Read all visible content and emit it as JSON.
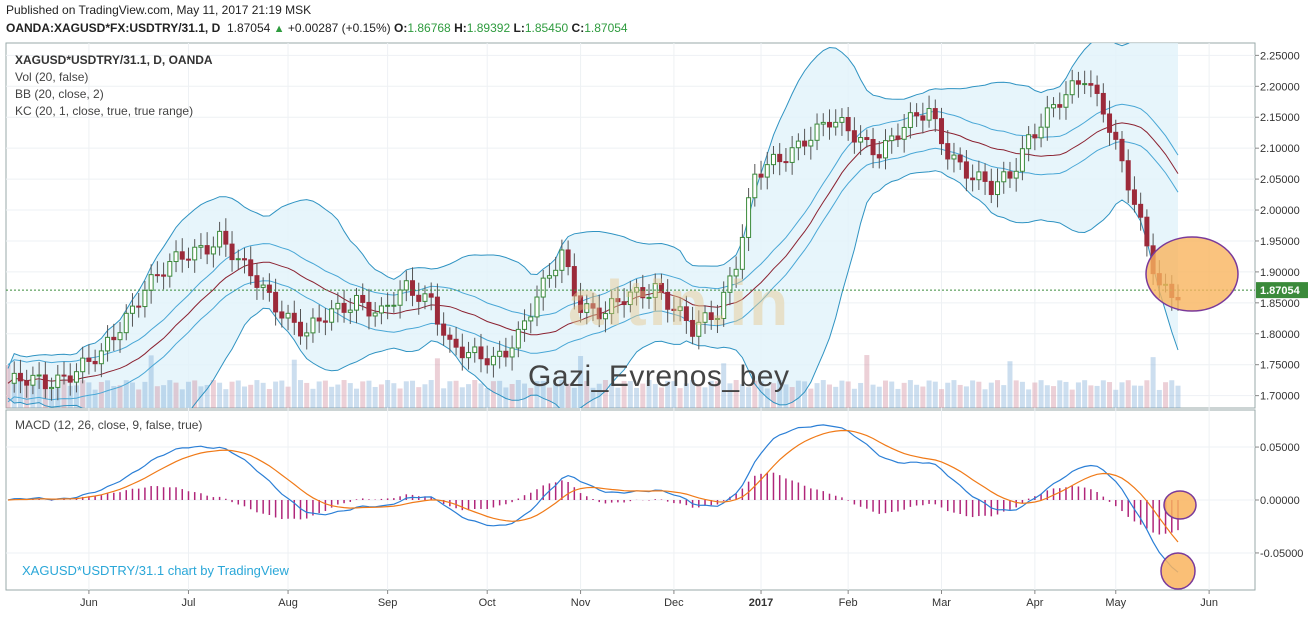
{
  "header": {
    "published": "Published on TradingView.com, May 11, 2017 21:19 MSK",
    "symbol_line": "OANDA:XAGUSD*FX:USDTRY/31.1, D",
    "last": "1.87054",
    "change": "+0.00287 (+0.15%)",
    "o_label": "O:",
    "o": "1.86768",
    "h_label": "H:",
    "h": "1.89392",
    "l_label": "L:",
    "l": "1.85450",
    "c_label": "C:",
    "c": "1.87054"
  },
  "legend": {
    "symbol": "XAGUSD*USDTRY/31.1, D, OANDA",
    "vol": "Vol (20, false)",
    "bb": "BB (20, close, 2)",
    "kc": "KC (20, 1, close, true, true range)",
    "macd": "MACD (12, 26, close, 9, false, true)",
    "credit": "XAGUSD*USDTRY/31.1 chart by TradingView"
  },
  "watermark": {
    "name": "Gazi_Evrenos_bey",
    "logo": "altin.in"
  },
  "colors": {
    "up": "#3a8a3a",
    "down": "#9c2a3a",
    "bb": "#2f93c2",
    "kc": "#49a7d6",
    "basis": "#8b2231",
    "band_fill": "#e1f2fa",
    "macd": "#2b7fd6",
    "signal": "#f07a18",
    "hist": "#b0267a",
    "highlight": "#f9b45e",
    "highlight_edge": "#7a3a9a"
  },
  "chart_data": [
    {
      "type": "line",
      "title": "XAGUSD*USDTRY/31.1, D, OANDA",
      "ylim": [
        1.68,
        2.27
      ],
      "yticks": [
        "2.25000",
        "2.20000",
        "2.15000",
        "2.10000",
        "2.05000",
        "2.00000",
        "1.95000",
        "1.90000",
        "1.85000",
        "1.80000",
        "1.75000",
        "1.70000"
      ],
      "last_price_label": "1.87054",
      "xticks": [
        "Jun",
        "Jul",
        "Aug",
        "Sep",
        "Oct",
        "Nov",
        "Dec",
        "2017",
        "Feb",
        "Mar",
        "Apr",
        "May",
        "Jun"
      ],
      "close_anchors": [
        [
          0,
          1.72
        ],
        [
          6,
          1.72
        ],
        [
          10,
          1.74
        ],
        [
          15,
          1.76
        ],
        [
          22,
          1.88
        ],
        [
          28,
          1.92
        ],
        [
          34,
          1.96
        ],
        [
          38,
          1.9
        ],
        [
          44,
          1.84
        ],
        [
          48,
          1.8
        ],
        [
          52,
          1.83
        ],
        [
          56,
          1.86
        ],
        [
          60,
          1.83
        ],
        [
          64,
          1.87
        ],
        [
          68,
          1.86
        ],
        [
          71,
          1.78
        ],
        [
          74,
          1.76
        ],
        [
          78,
          1.76
        ],
        [
          82,
          1.8
        ],
        [
          86,
          1.87
        ],
        [
          89,
          1.93
        ],
        [
          92,
          1.85
        ],
        [
          96,
          1.83
        ],
        [
          100,
          1.86
        ],
        [
          104,
          1.88
        ],
        [
          107,
          1.84
        ],
        [
          110,
          1.8
        ],
        [
          114,
          1.84
        ],
        [
          117,
          1.92
        ],
        [
          120,
          2.05
        ],
        [
          124,
          2.08
        ],
        [
          128,
          2.12
        ],
        [
          132,
          2.14
        ],
        [
          136,
          2.12
        ],
        [
          140,
          2.1
        ],
        [
          144,
          2.13
        ],
        [
          148,
          2.16
        ],
        [
          151,
          2.1
        ],
        [
          155,
          2.05
        ],
        [
          158,
          2.03
        ],
        [
          161,
          2.06
        ],
        [
          164,
          2.12
        ],
        [
          167,
          2.15
        ],
        [
          170,
          2.18
        ],
        [
          173,
          2.22
        ],
        [
          176,
          2.17
        ],
        [
          179,
          2.07
        ],
        [
          182,
          1.97
        ],
        [
          185,
          1.88
        ],
        [
          188,
          1.87
        ]
      ],
      "series": [
        {
          "name": "Vol (20, false)"
        },
        {
          "name": "BB (20, close, 2)"
        },
        {
          "name": "KC (20, 1, close, true, true range)"
        }
      ]
    },
    {
      "type": "line",
      "title": "MACD (12, 26, close, 9, false, true)",
      "ylim": [
        -0.085,
        0.085
      ],
      "yticks": [
        "0.05000",
        "0.00000",
        "-0.05000"
      ],
      "series": [
        {
          "name": "MACD"
        },
        {
          "name": "Signal"
        },
        {
          "name": "Histogram"
        }
      ]
    }
  ]
}
